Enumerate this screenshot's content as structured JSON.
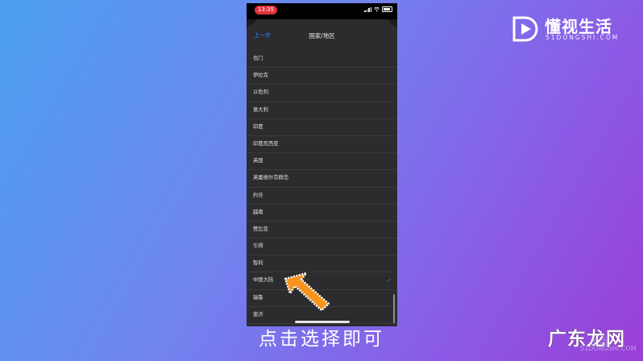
{
  "status_bar": {
    "time": "13:35"
  },
  "nav": {
    "back_label": "上一步",
    "title": "国家/地区"
  },
  "countries": [
    {
      "label": "也门"
    },
    {
      "label": "伊拉克"
    },
    {
      "label": "以色列"
    },
    {
      "label": "意大利"
    },
    {
      "label": "印度"
    },
    {
      "label": "印度尼西亚"
    },
    {
      "label": "英国"
    },
    {
      "label": "英属维尔京群岛"
    },
    {
      "label": "约旦"
    },
    {
      "label": "越南"
    },
    {
      "label": "赞比亚"
    },
    {
      "label": "乍得"
    },
    {
      "label": "智利"
    },
    {
      "label": "中国大陆",
      "selected": true
    },
    {
      "label": "瑞鲁"
    },
    {
      "label": "斐济"
    }
  ],
  "selected_country": "中国大陆",
  "icons": {
    "check": "checkmark-icon",
    "arrow": "pointer-arrow-icon"
  },
  "caption": "点击选择即可",
  "brand": {
    "name": "懂视生活",
    "sub": "51DONGSHI.COM"
  },
  "watermark": {
    "name": "广东龙网",
    "sub": "51DONGSHI.COM",
    "small_logo": "生活"
  },
  "colors": {
    "accent": "#2e8cf0",
    "arrow": "#f7931e",
    "time_pill": "#e0303a",
    "sheet": "#2c2c2e"
  }
}
